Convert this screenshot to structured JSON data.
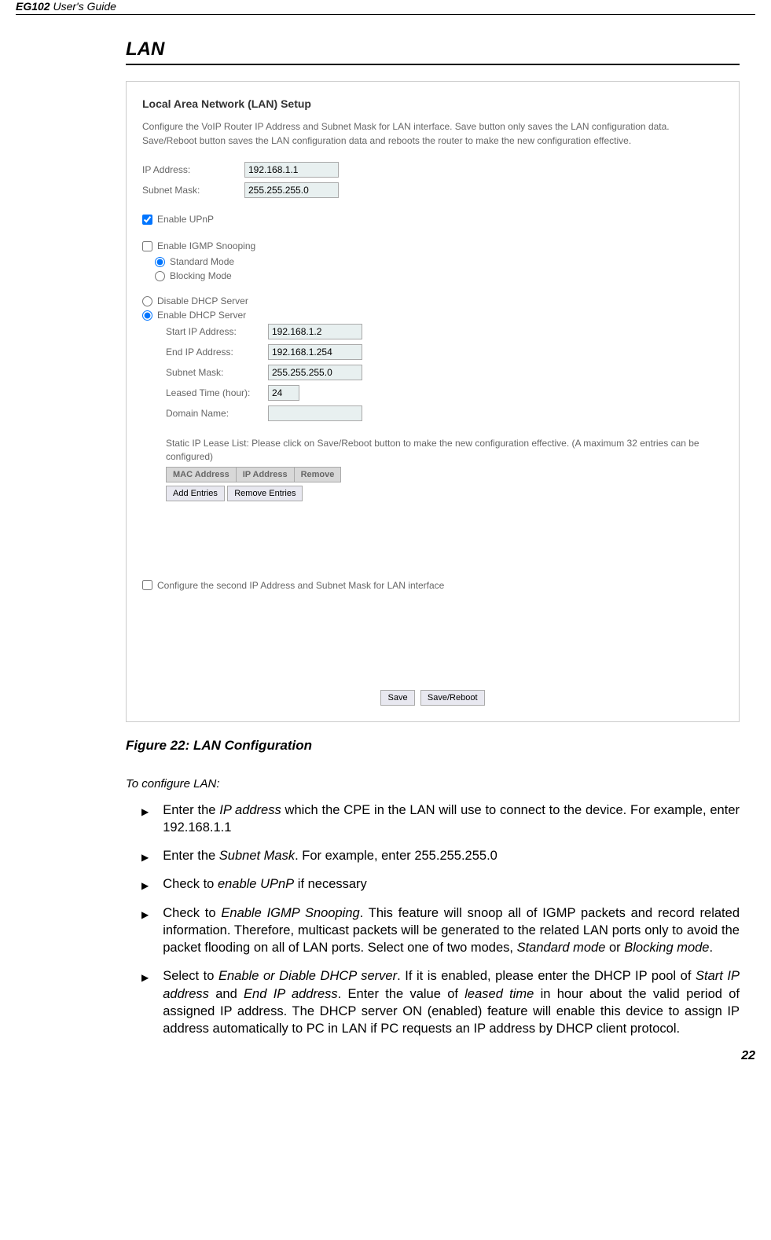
{
  "header": {
    "product": "EG102",
    "doc": " User's Guide"
  },
  "section_title": "LAN",
  "screenshot": {
    "title": "Local Area Network (LAN) Setup",
    "description": "Configure the VoIP Router IP Address and Subnet Mask for LAN interface.  Save button only saves the LAN configuration data. Save/Reboot button saves the LAN configuration data and reboots the router to make the new configuration effective.",
    "ip_label": "IP Address:",
    "ip_value": "192.168.1.1",
    "subnet_label": "Subnet Mask:",
    "subnet_value": "255.255.255.0",
    "enable_upnp": "Enable UPnP",
    "enable_igmp": "Enable IGMP Snooping",
    "standard_mode": "Standard Mode",
    "blocking_mode": "Blocking Mode",
    "disable_dhcp": "Disable DHCP Server",
    "enable_dhcp": "Enable DHCP Server",
    "start_ip_label": "Start IP Address:",
    "start_ip_value": "192.168.1.2",
    "end_ip_label": "End IP Address:",
    "end_ip_value": "192.168.1.254",
    "dhcp_subnet_label": "Subnet Mask:",
    "dhcp_subnet_value": "255.255.255.0",
    "leased_label": "Leased Time (hour):",
    "leased_value": "24",
    "domain_label": "Domain Name:",
    "domain_value": "",
    "static_ip_text": "Static IP Lease List: Please click on Save/Reboot button to make the new configuration effective. (A maximum 32 entries can be configured)",
    "th_mac": "MAC Address",
    "th_ip": "IP Address",
    "th_remove": "Remove",
    "btn_add": "Add Entries",
    "btn_remove": "Remove Entries",
    "second_ip": "Configure the second IP Address and Subnet Mask for LAN interface",
    "btn_save": "Save",
    "btn_save_reboot": "Save/Reboot"
  },
  "figure_caption": "Figure 22: LAN Configuration",
  "config_heading": "To configure LAN:",
  "bullets": [
    {
      "pre": "Enter the ",
      "em1": "IP address",
      "post": " which the CPE in the LAN will use to connect to the device. For example, enter 192.168.1.1"
    },
    {
      "pre": "Enter the ",
      "em1": "Subnet Mask",
      "post": ". For example, enter 255.255.255.0"
    },
    {
      "pre": "Check to ",
      "em1": "enable UPnP",
      "post": " if necessary"
    },
    {
      "pre": "Check to ",
      "em1": "Enable IGMP Snooping",
      "mid1": ". This feature will snoop all of IGMP packets and record related information. Therefore, multicast packets will be generated to the related LAN ports only to avoid the packet flooding on all of LAN ports. Select one of two modes, ",
      "em2": "Standard mode",
      "mid2": " or ",
      "em3": "Blocking mode",
      "post": "."
    },
    {
      "pre": "Select to ",
      "em1": "Enable or Diable DHCP server",
      "mid1": ". If it is enabled, please enter the DHCP IP pool of ",
      "em2": "Start IP address",
      "mid2": " and ",
      "em3": "End IP address",
      "mid3": ". Enter the value of ",
      "em4": "leased time",
      "post": " in hour about the valid period of assigned IP address. The DHCP server ON (enabled) feature will enable this device to assign IP address automatically to PC in LAN if PC requests an IP address by DHCP client protocol."
    }
  ],
  "page_num": "22"
}
